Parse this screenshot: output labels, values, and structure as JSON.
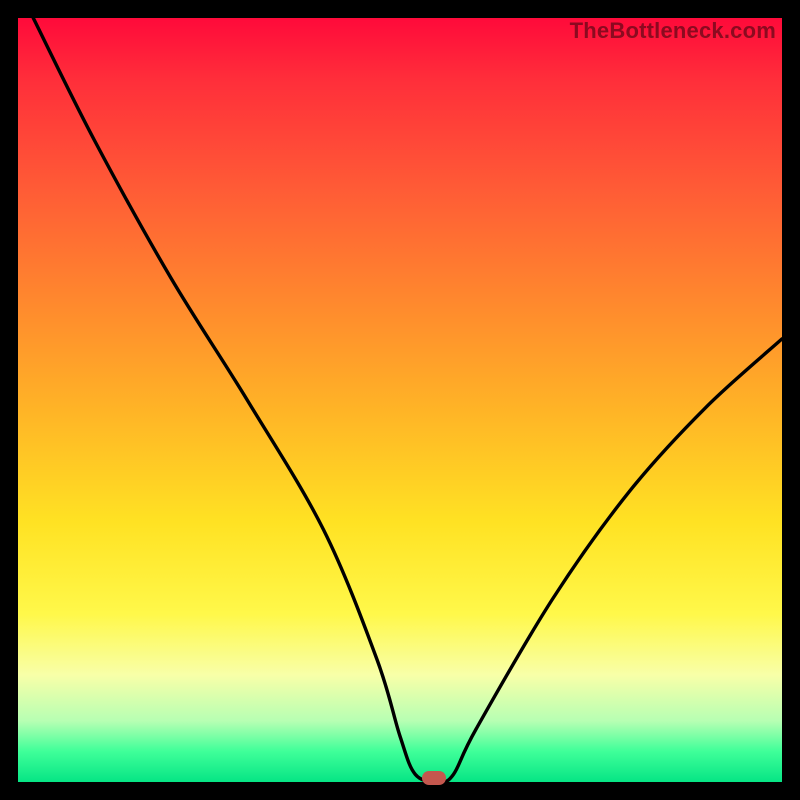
{
  "watermark": "TheBottleneck.com",
  "chart_data": {
    "type": "line",
    "title": "",
    "xlabel": "",
    "ylabel": "",
    "xlim": [
      0,
      100
    ],
    "ylim": [
      0,
      100
    ],
    "grid": false,
    "series": [
      {
        "name": "bottleneck-curve",
        "x": [
          2,
          10,
          20,
          30,
          40,
          47,
          50,
          52,
          55,
          57,
          60,
          70,
          80,
          90,
          100
        ],
        "y": [
          100,
          84,
          66,
          50,
          33,
          16,
          6,
          1,
          0,
          1,
          7,
          24,
          38,
          49,
          58
        ]
      }
    ],
    "marker": {
      "x": 54.5,
      "y": 0.5,
      "color": "#c4574e"
    }
  }
}
